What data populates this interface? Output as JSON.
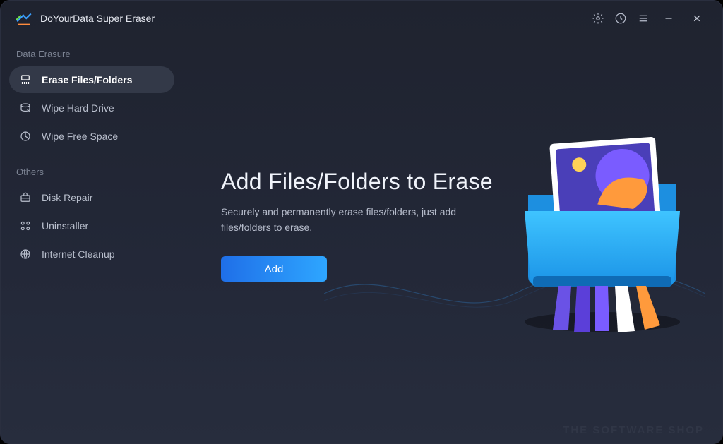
{
  "app": {
    "title": "DoYourData Super Eraser"
  },
  "titlebar": {
    "settings": "Settings",
    "history": "History",
    "menu": "Menu",
    "minimize": "Minimize",
    "close": "Close"
  },
  "sidebar": {
    "sections": [
      {
        "label": "Data Erasure",
        "items": [
          {
            "icon": "shredder-icon",
            "label": "Erase Files/Folders",
            "active": true
          },
          {
            "icon": "disk-wipe-icon",
            "label": "Wipe Hard Drive",
            "active": false
          },
          {
            "icon": "pie-icon",
            "label": "Wipe Free Space",
            "active": false
          }
        ]
      },
      {
        "label": "Others",
        "items": [
          {
            "icon": "toolbox-icon",
            "label": "Disk Repair",
            "active": false
          },
          {
            "icon": "grid-icon",
            "label": "Uninstaller",
            "active": false
          },
          {
            "icon": "globe-clean-icon",
            "label": "Internet Cleanup",
            "active": false
          }
        ]
      }
    ]
  },
  "main": {
    "heading": "Add Files/Folders to Erase",
    "subtext": "Securely and permanently erase files/folders, just add files/folders to erase.",
    "add_button": "Add"
  },
  "watermark": "THE SOFTWARE SHOP"
}
